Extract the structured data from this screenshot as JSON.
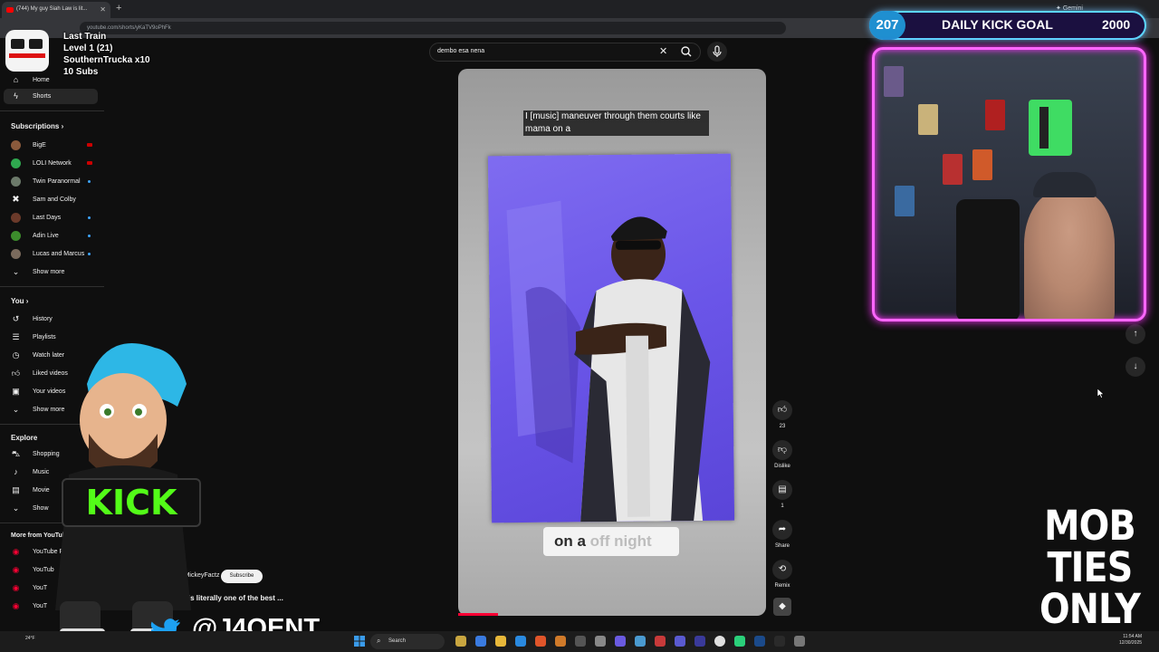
{
  "browser": {
    "tab_title": "(744) My guy Siah Law is lit...",
    "url": "youtube.com/shorts/yKaTV9oPhFk",
    "gemini_label": "Gemini"
  },
  "sidebar": {
    "items": [
      {
        "label": "Home"
      },
      {
        "label": "Shorts"
      }
    ],
    "subscriptions_header": "Subscriptions",
    "subscriptions": [
      {
        "label": "BigE",
        "indicator": "live"
      },
      {
        "label": "LOLI Network",
        "indicator": "live"
      },
      {
        "label": "Twin Paranormal",
        "indicator": "dot"
      },
      {
        "label": "Sam and Colby",
        "indicator": ""
      },
      {
        "label": "Last Days",
        "indicator": "dot"
      },
      {
        "label": "Adin Live",
        "indicator": "dot"
      },
      {
        "label": "Lucas and Marcus",
        "indicator": "dot"
      }
    ],
    "show_more": "Show more",
    "you_header": "You",
    "you_items": [
      {
        "label": "History"
      },
      {
        "label": "Playlists"
      },
      {
        "label": "Watch later"
      },
      {
        "label": "Liked videos"
      },
      {
        "label": "Your videos"
      },
      {
        "label": "Show more"
      }
    ],
    "explore_header": "Explore",
    "explore_items": [
      {
        "label": "Shopping"
      },
      {
        "label": "Music"
      },
      {
        "label": "Movie"
      },
      {
        "label": "Show"
      }
    ],
    "more_header": "More from YouTube",
    "more_items": [
      {
        "label": "YouTube Pr"
      },
      {
        "label": "YouTub"
      },
      {
        "label": "YouT"
      },
      {
        "label": "YouT"
      }
    ]
  },
  "search": {
    "query": "dembo esa nena"
  },
  "short": {
    "caption": "I [music] maneuver through them courts like mama on a",
    "lyric_part1": "on a ",
    "lyric_part2": "off night",
    "channel": "@TheRealMickeyFactz",
    "subscribe_label": "Subscribe",
    "title": "Siah Law is literally one of the best ...",
    "progress": 0.13
  },
  "actions": {
    "like_count": "23",
    "dislike_label": "Dislike",
    "comments_count": "1",
    "share_label": "Share",
    "remix_label": "Remix"
  },
  "overlay": {
    "last_train": "Last Train",
    "level": "Level 1  (21)",
    "trucka": "SouthernTrucka x10",
    "subs": "10 Subs",
    "goal_current": "207",
    "goal_title": "DAILY KICK GOAL",
    "goal_target": "2000",
    "kick_sign": "KICK",
    "twitter_handle": "@J4OENT",
    "mob_line1": "MOB",
    "mob_line2": "TIES",
    "mob_line3": "ONLY"
  },
  "taskbar": {
    "search_placeholder": "Search",
    "time": "11:54 AM",
    "date": "12/30/2025",
    "weather": "24°F"
  },
  "colors": {
    "youtube_red": "#ff0000",
    "kick_green": "#53fc18",
    "neon_pink": "#ff66ff",
    "goal_blue": "#5cd6ff"
  }
}
